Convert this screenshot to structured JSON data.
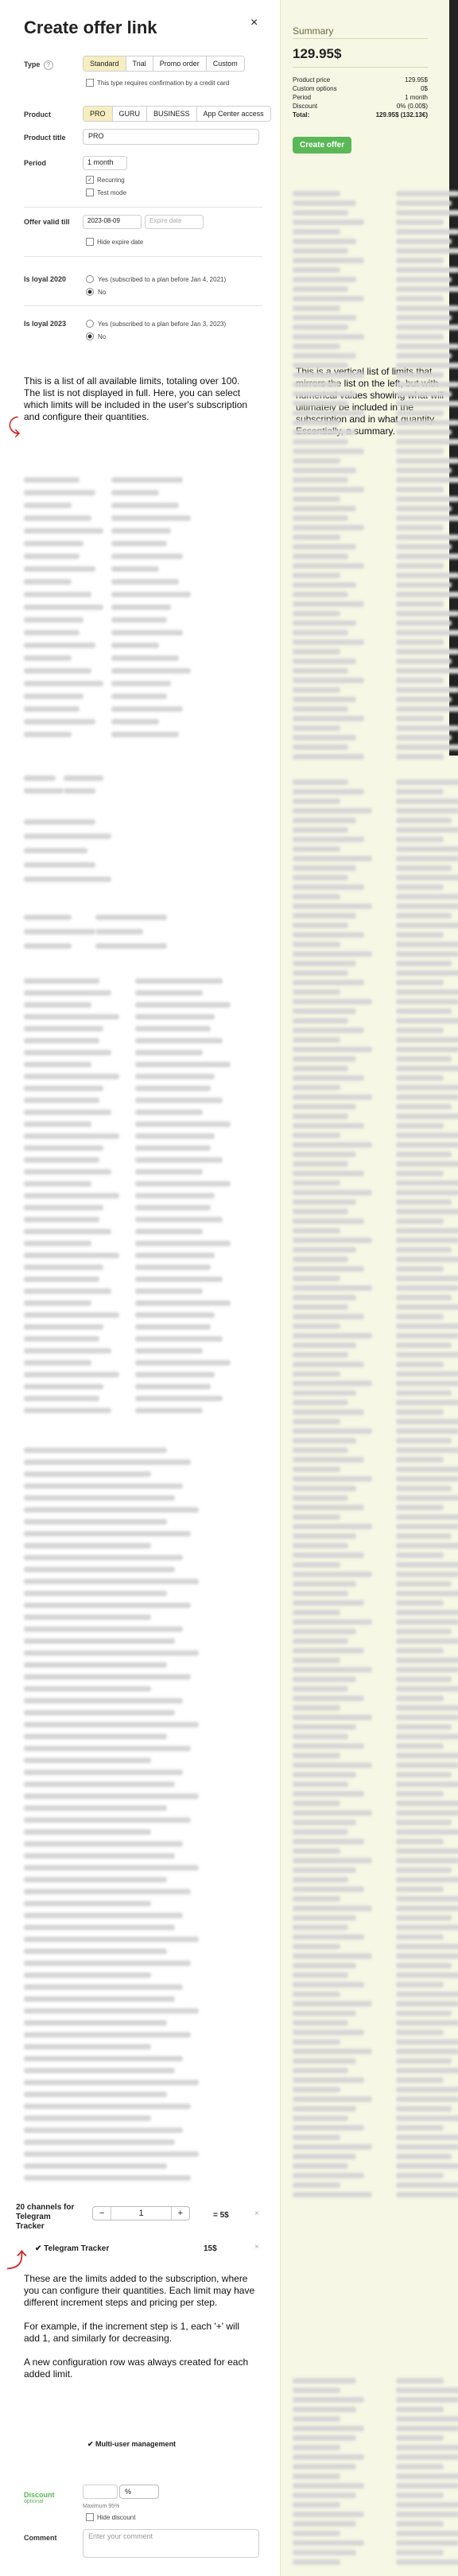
{
  "modal": {
    "title": "Create offer link",
    "close": "×"
  },
  "type": {
    "label": "Type",
    "info": "?",
    "options": [
      "Standard",
      "Trial",
      "Promo order",
      "Custom"
    ],
    "selected": "Standard",
    "confirm_label": "This type requires confirmation by a credit card"
  },
  "product": {
    "label": "Product",
    "options": [
      "PRO",
      "GURU",
      "BUSINESS",
      "App Center access"
    ],
    "selected": "PRO"
  },
  "product_title": {
    "label": "Product title",
    "value": "PRO"
  },
  "period": {
    "label": "Period",
    "value": "1 month",
    "recurring_label": "Recurring",
    "test_mode_label": "Test mode"
  },
  "offer_valid": {
    "label": "Offer valid till",
    "date_value": "2023-08-09",
    "expire_placeholder": "Expire date",
    "hide_expire_label": "Hide expire date"
  },
  "loyal_2020": {
    "label": "Is loyal 2020",
    "yes_label": "Yes (subscribed to a plan before Jan 4, 2021)",
    "no_label": "No"
  },
  "loyal_2023": {
    "label": "Is loyal 2023",
    "yes_label": "Yes (subscribed to a plan before Jan 3, 2023)",
    "no_label": "No"
  },
  "notes": {
    "limits_list": "This is a list of all available limits, totaling over 100. The list is not displayed in full. Here, you can select which limits will be included in the user's subscription and configure their quantities.",
    "summary_list": "This is a vertical list of limits that mirrors the list on the left, but with numerical values showing what will ultimately be included in the subscription and in what quantity.\nEssentially, a summary.",
    "added_limits_1": "These are the limits added to the subscription, where you can configure their quantities. Each limit may have different increment steps and pricing per step.",
    "added_limits_2": "For example, if the increment step is 1, each '+' will add 1, and similarly for decreasing.",
    "added_limits_3": "A new configuration row was always created for each added limit."
  },
  "summary": {
    "title": "Summary",
    "price": "129.95$",
    "rows": [
      {
        "k": "Product price",
        "v": "129.95$"
      },
      {
        "k": "Custom options",
        "v": "0$"
      },
      {
        "k": "Period",
        "v": "1 month"
      },
      {
        "k": "Discount",
        "v": "0% (0.00$)"
      },
      {
        "k": "Total:",
        "v": "129.95$ (132.13€)"
      }
    ],
    "create_button": "Create offer"
  },
  "added_limit": {
    "title_line1": "20 channels for",
    "title_line2": "Telegram",
    "title_line3": "Tracker",
    "minus": "−",
    "value": "1",
    "plus": "+",
    "price": "= 5$",
    "chip_label": "✔ Telegram Tracker",
    "chip_price": "15$"
  },
  "multi_user": {
    "label": "✔ Multi-user management"
  },
  "discount": {
    "label": "Discount",
    "sub": "optional",
    "unit": "%",
    "max_label": "Maximum 95%",
    "hide_label": "Hide discount"
  },
  "comment": {
    "label": "Comment",
    "placeholder": "Enter your comment"
  }
}
